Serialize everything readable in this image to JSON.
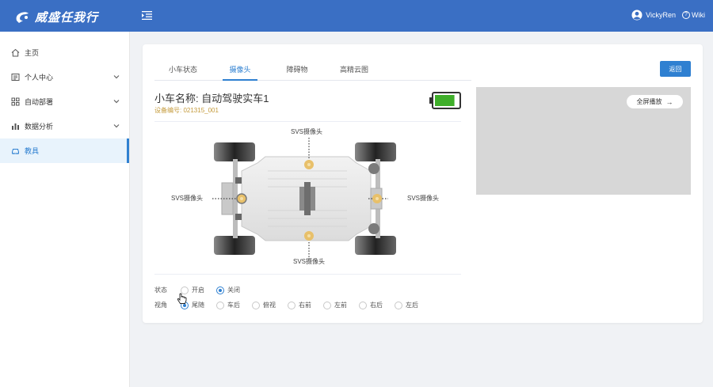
{
  "header": {
    "app_name": "威盛任我行",
    "user_name": "VickyRen",
    "wiki_label": "Wiki",
    "bg_color": "#3a6fc4"
  },
  "sidebar": {
    "items": [
      {
        "label": "主页",
        "icon": "home-icon",
        "has_submenu": false
      },
      {
        "label": "个人中心",
        "icon": "profile-icon",
        "has_submenu": true
      },
      {
        "label": "自动部署",
        "icon": "apps-icon",
        "has_submenu": true
      },
      {
        "label": "数据分析",
        "icon": "chart-icon",
        "has_submenu": true
      },
      {
        "label": "教具",
        "icon": "car-icon",
        "has_submenu": false,
        "active": true
      }
    ]
  },
  "tabs": [
    {
      "label": "小车状态"
    },
    {
      "label": "摄像头",
      "active": true
    },
    {
      "label": "障碍物"
    },
    {
      "label": "高精云图"
    }
  ],
  "back_button": "返回",
  "car": {
    "name": "小车名称: 自动驾驶实车1",
    "device_id": "设备编号: 021315_001",
    "battery_level": 0.85
  },
  "cameras": {
    "front": "SVS摄像头",
    "left": "SVS摄像头",
    "right": "SVS摄像头",
    "rear": "SVS摄像头"
  },
  "video": {
    "fullscreen_label": "全屏播放"
  },
  "status": {
    "label": "状态",
    "options": [
      "开启",
      "关闭"
    ],
    "selected": "关闭"
  },
  "view": {
    "label": "视角",
    "options": [
      "尾随",
      "车后",
      "俯视",
      "右前",
      "左前",
      "右后",
      "左后"
    ],
    "selected": "尾随"
  },
  "colors": {
    "accent": "#2f80d1",
    "camera_marker": "#e8c06a",
    "battery_fill": "#3fae2a",
    "device_id": "#c49a3a"
  }
}
